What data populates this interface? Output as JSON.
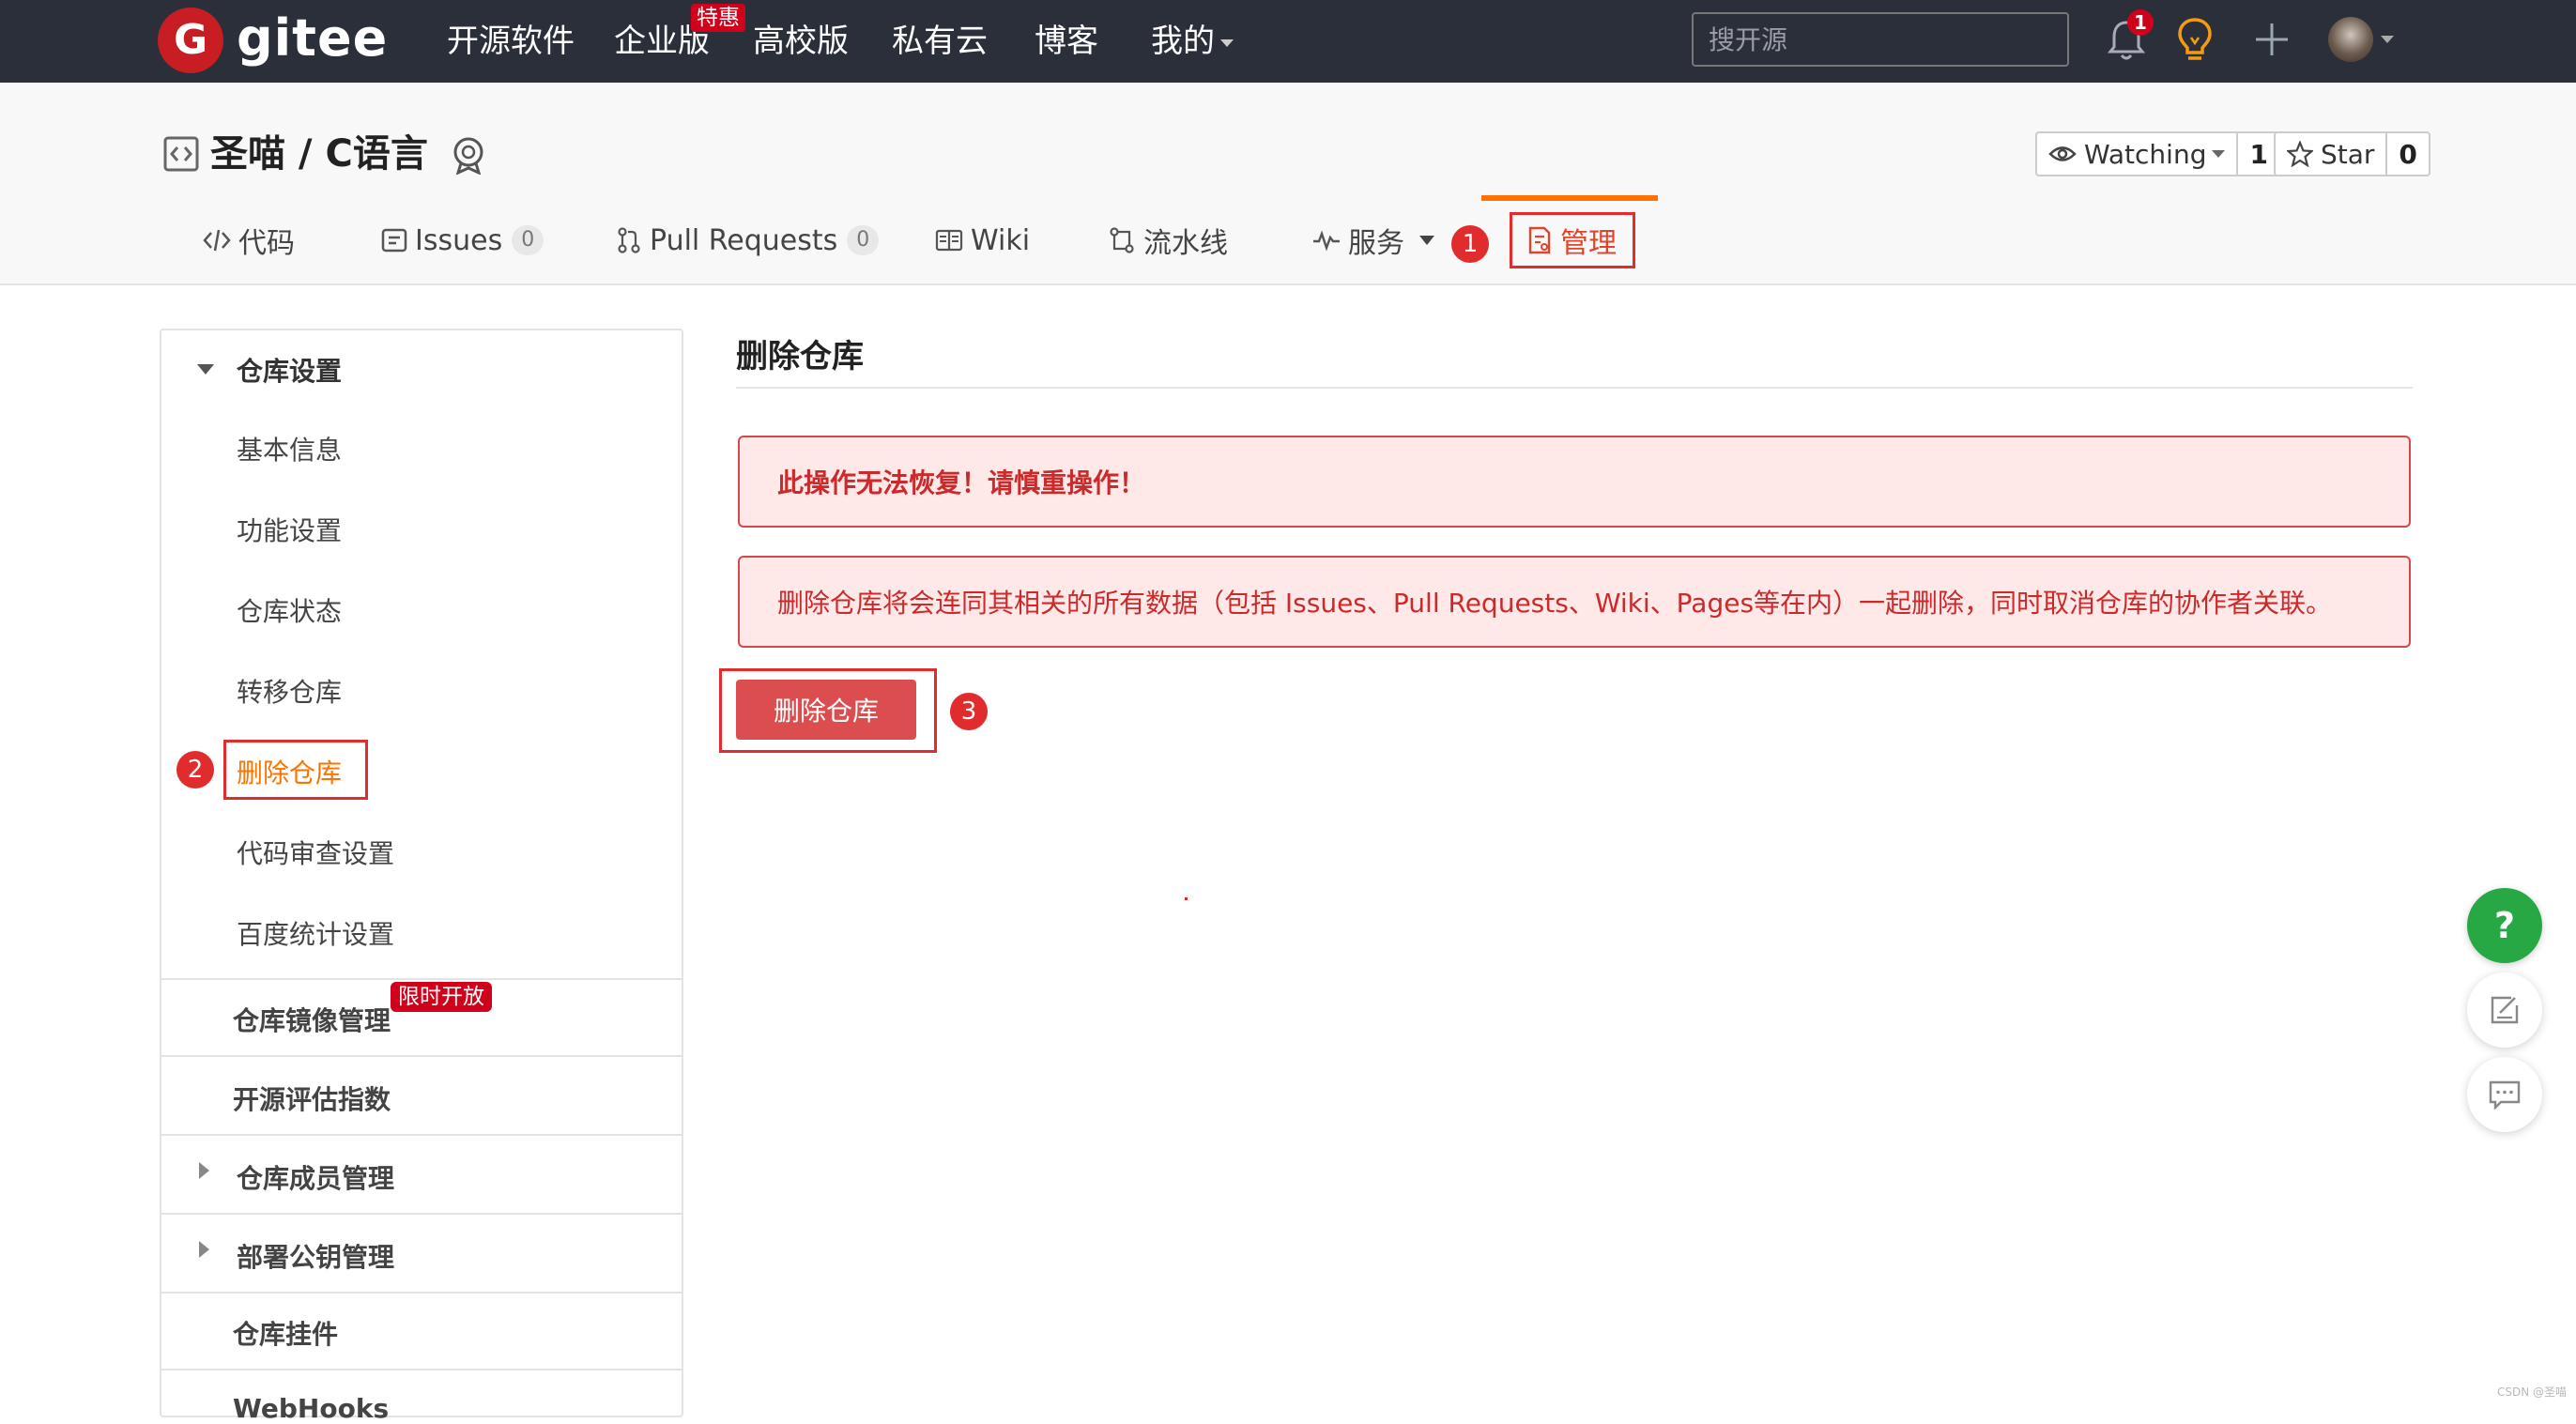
{
  "topbar": {
    "logo_letter": "G",
    "logo_text": "gitee",
    "nav": [
      "开源软件",
      "企业版",
      "高校版",
      "私有云",
      "博客",
      "我的"
    ],
    "enterprise_badge": "特惠",
    "search_placeholder": "搜开源",
    "notification_count": "1",
    "icons": [
      "bell-icon",
      "lightbulb-icon",
      "plus-icon",
      "avatar"
    ]
  },
  "repo": {
    "title": "圣喵 / C语言",
    "watch_label": "Watching",
    "watch_count": "1",
    "star_label": "Star",
    "star_count": "0"
  },
  "tabs": [
    {
      "label": "代码",
      "icon": "code-icon"
    },
    {
      "label": "Issues",
      "count": "0",
      "icon": "issues-icon"
    },
    {
      "label": "Pull Requests",
      "count": "0",
      "icon": "pull-request-icon"
    },
    {
      "label": "Wiki",
      "icon": "wiki-icon"
    },
    {
      "label": "流水线",
      "icon": "pipeline-icon"
    },
    {
      "label": "服务",
      "icon": "activity-icon"
    },
    {
      "label": "管理",
      "icon": "manage-icon",
      "active": true
    }
  ],
  "annotations": [
    "1",
    "2",
    "3"
  ],
  "sidebar": {
    "section_title": "仓库设置",
    "items": [
      "基本信息",
      "功能设置",
      "仓库状态",
      "转移仓库",
      "删除仓库",
      "代码审查设置",
      "百度统计设置"
    ],
    "active_item": "删除仓库",
    "groups": [
      "仓库镜像管理",
      "开源评估指数",
      "仓库成员管理",
      "部署公钥管理",
      "仓库挂件",
      "WebHooks"
    ],
    "limited_badge": "限时开放"
  },
  "main": {
    "title": "删除仓库",
    "warning": "此操作无法恢复！请慎重操作！",
    "description": "删除仓库将会连同其相关的所有数据（包括 Issues、Pull Requests、Wiki、Pages等在内）一起删除，同时取消仓库的协作者关联。",
    "delete_button": "删除仓库"
  },
  "floating": {
    "help_label": "?"
  },
  "watermark": "CSDN @圣喵",
  "colors": {
    "navbar": "#2b2f3a",
    "accent": "#fe7300",
    "danger": "#db4d4e",
    "annotation": "#e02c2c",
    "help": "#27a844"
  }
}
